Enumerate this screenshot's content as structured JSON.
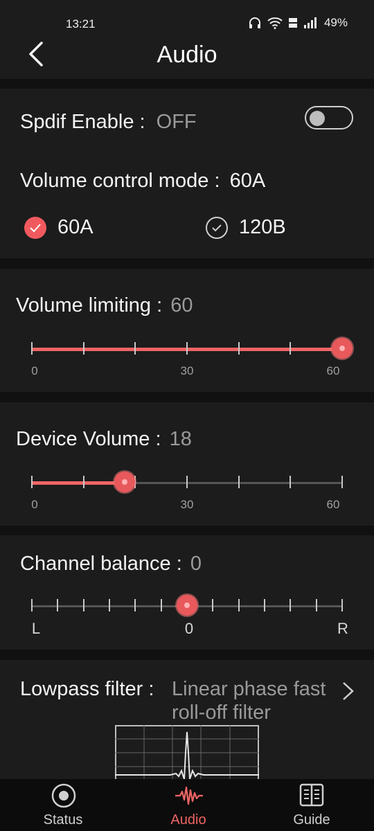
{
  "status_bar": {
    "time": "13:21",
    "battery": "49%"
  },
  "header": {
    "title": "Audio"
  },
  "spdif": {
    "label": "Spdif Enable :",
    "value": "OFF"
  },
  "volume_mode": {
    "label": "Volume control mode :",
    "value": "60A",
    "options": [
      {
        "label": "60A",
        "selected": true
      },
      {
        "label": "120B",
        "selected": false
      }
    ]
  },
  "volume_limiting": {
    "label": "Volume limiting :",
    "value": "60",
    "min_label": "0",
    "mid_label": "30",
    "max_label": "60"
  },
  "device_volume": {
    "label": "Device Volume :",
    "value": "18",
    "min_label": "0",
    "mid_label": "30",
    "max_label": "60"
  },
  "channel_balance": {
    "label": "Channel balance :",
    "value": "0",
    "left_label": "L",
    "mid_label": "0",
    "right_label": "R"
  },
  "lowpass": {
    "label": "Lowpass filter :",
    "value_line1": "Linear phase fast",
    "value_line2": "roll-off filter"
  },
  "tabs": [
    {
      "label": "Status"
    },
    {
      "label": "Audio"
    },
    {
      "label": "Guide"
    }
  ],
  "colors": {
    "accent": "#ef6565",
    "background": "#111111",
    "card": "#1c1c1c"
  },
  "sliders": {
    "volume_limiting_fraction": 1.0,
    "device_volume_fraction": 0.3,
    "channel_balance_fraction": 0.5
  }
}
